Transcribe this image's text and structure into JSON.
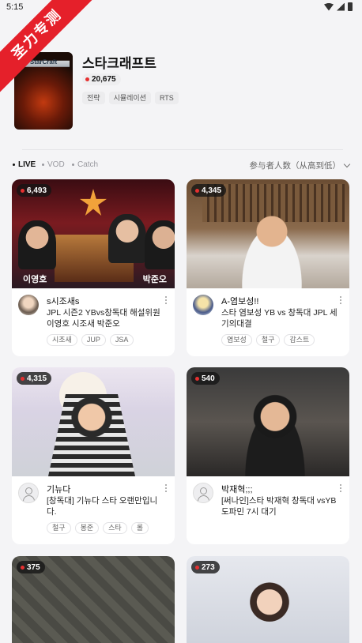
{
  "status_bar": {
    "time": "5:15"
  },
  "watermark": {
    "text": "圣力专测"
  },
  "game": {
    "title": "스타크래프트",
    "cover_logo": "StarCraft",
    "viewer_count": "20,675",
    "tags": [
      "전략",
      "시뮬레이션",
      "RTS"
    ]
  },
  "filters": {
    "tabs": [
      "LIVE",
      "VOD",
      "Catch"
    ],
    "active_tab": "LIVE",
    "sort_label": "参与者人数（从高到低）"
  },
  "streams": [
    {
      "viewers": "6,493",
      "streamer": "s시조새s",
      "title": "JPL 시즌2 YBvs창독대 해설위원 이영호 시조새 박준오",
      "tags": [
        "시조새",
        "JUP",
        "JSA"
      ],
      "overlay_left": "이영호",
      "overlay_right": "박준오"
    },
    {
      "viewers": "4,345",
      "streamer": "A-염보성!!",
      "title": "스타 염보성 YB vs 창독대 JPL 세기의대결",
      "tags": [
        "염보성",
        "철구",
        "감스트"
      ]
    },
    {
      "viewers": "4,315",
      "streamer": "기뉴다",
      "title": "[창독대] 기뉴다 스타 오랜만입니다.",
      "tags": [
        "철구",
        "봉준",
        "스타",
        "롤"
      ]
    },
    {
      "viewers": "540",
      "streamer": "박재혁;;;",
      "title": "[써나인]스타 박재혁 창독대 vsYB 도파민 7시 대기",
      "tags": []
    },
    {
      "viewers": "375"
    },
    {
      "viewers": "273"
    }
  ]
}
